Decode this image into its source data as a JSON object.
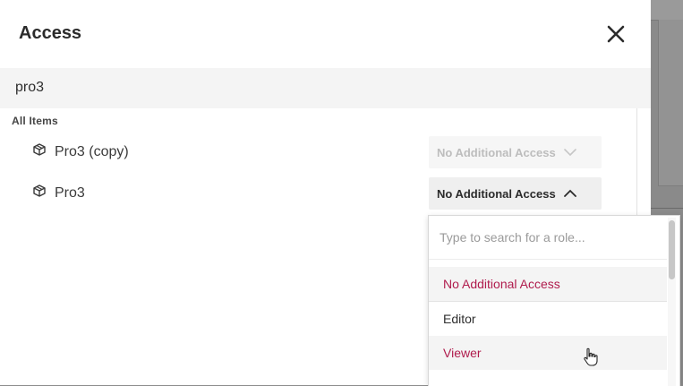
{
  "modal": {
    "title": "Access",
    "close_icon": "close-icon"
  },
  "search": {
    "value": "pro3"
  },
  "list": {
    "section_label": "All Items",
    "items": [
      {
        "name": "Pro3 (copy)",
        "icon": "package-icon",
        "access": "No Additional Access",
        "state": "disabled"
      },
      {
        "name": "Pro3",
        "icon": "package-icon",
        "access": "No Additional Access",
        "state": "open"
      }
    ]
  },
  "dropdown": {
    "placeholder": "Type to search for a role...",
    "options": [
      {
        "label": "No Additional Access",
        "state": "selected"
      },
      {
        "label": "Editor",
        "state": "normal"
      },
      {
        "label": "Viewer",
        "state": "hover"
      }
    ]
  },
  "colors": {
    "accent": "#b01c4d",
    "overlay": "#8c8c8c",
    "search_bg": "#f4f4f4"
  }
}
